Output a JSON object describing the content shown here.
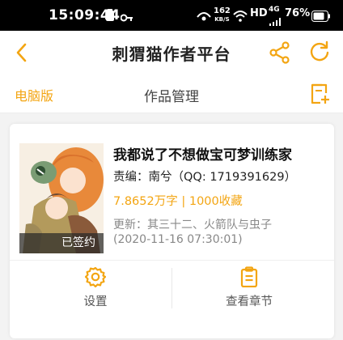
{
  "status_bar": {
    "time": "15:09:44",
    "network_speed": "162",
    "network_unit": "KB/S",
    "hd": "HD",
    "signal": "4G",
    "battery": "76%"
  },
  "header": {
    "title": "刺猬猫作者平台"
  },
  "subbar": {
    "desktop_link": "电脑版",
    "title": "作品管理"
  },
  "book": {
    "title": "我都说了不想做宝可梦训练家",
    "editor": "责编：南兮（QQ: 1719391629）",
    "stats": "7.8652万字 | 1000收藏",
    "update": "更新：其三十二、火箭队与虫子",
    "update_time": "(2020-11-16 07:30:01)",
    "badge": "已签约"
  },
  "actions": {
    "settings_label": "设置",
    "chapters_label": "查看章节"
  },
  "colors": {
    "accent": "#f3a512",
    "statusbar_bg": "#000000",
    "page_bg": "#f3f3f3"
  }
}
